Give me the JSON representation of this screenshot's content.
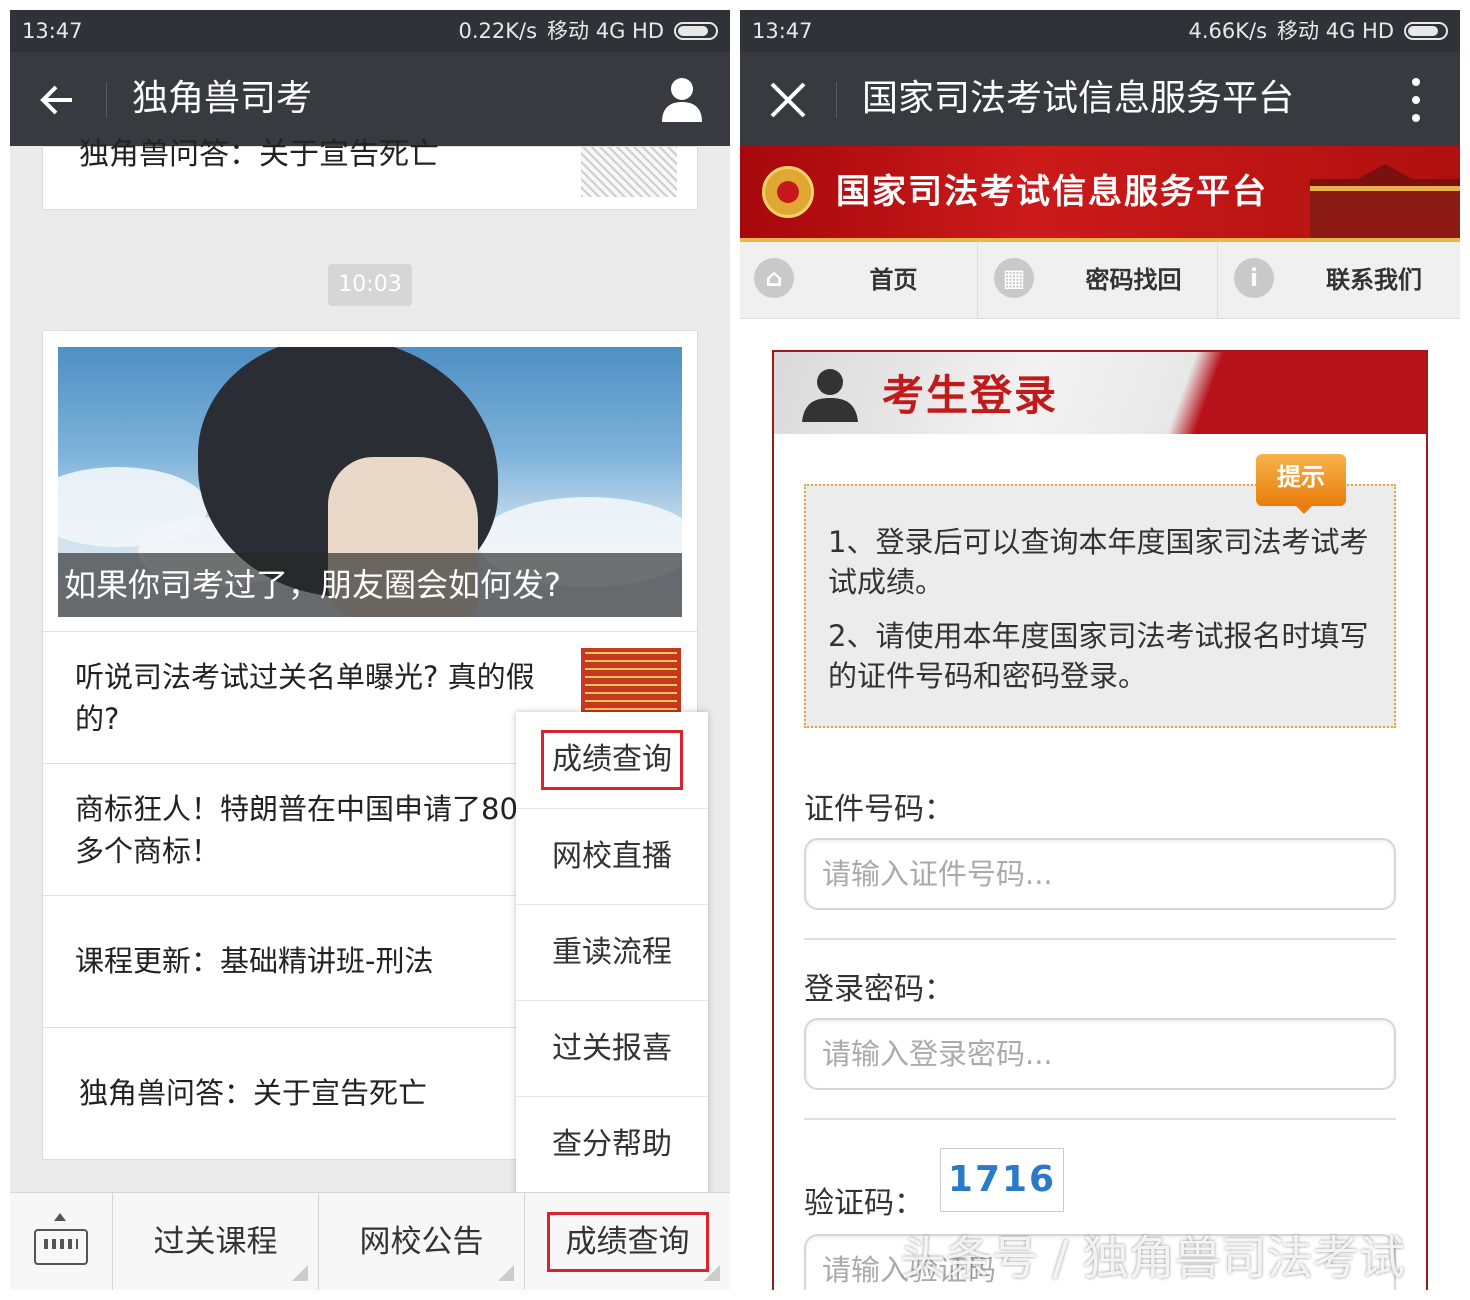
{
  "left": {
    "status": {
      "time": "13:47",
      "speed": "0.22K/s",
      "carrier": "移动 4G HD"
    },
    "title": "独角兽司考",
    "top_card_text": "独角兽问答：关于宣告死亡",
    "time_badge": "10:03",
    "hero_caption": "如果你司考过了，朋友圈会如何发?",
    "items": [
      {
        "text": "听说司法考试过关名单曝光? 真的假的?"
      },
      {
        "text": "商标狂人！特朗普在中国申请了80多个商标！"
      },
      {
        "text": "课程更新：基础精讲班-刑法"
      },
      {
        "text": "独角兽问答：关于宣告死亡"
      }
    ],
    "popup_menu": [
      "成绩查询",
      "网校直播",
      "重读流程",
      "过关报喜",
      "查分帮助"
    ],
    "bottom_menu": [
      "过关课程",
      "网校公告",
      "成绩查询"
    ]
  },
  "right": {
    "status": {
      "time": "13:47",
      "speed": "4.66K/s",
      "carrier": "移动 4G HD"
    },
    "title": "国家司法考试信息服务平台",
    "banner_title": "国家司法考试信息服务平台",
    "nav": [
      "首页",
      "密码找回",
      "联系我们"
    ],
    "login_title": "考生登录",
    "tip_tag": "提示",
    "tips": [
      "1、登录后可以查询本年度国家司法考试考试成绩。",
      "2、请使用本年度国家司法考试报名时填写的证件号码和密码登录。"
    ],
    "id_label": "证件号码：",
    "id_placeholder": "请输入证件号码...",
    "pwd_label": "登录密码：",
    "pwd_placeholder": "请输入登录密码...",
    "captcha_label": "验证码：",
    "captcha_value": "1716",
    "captcha_placeholder": "请输入验证码"
  },
  "watermark": "头条号 / 独角兽司法考试",
  "colors": {
    "titlebar": "#393a3f",
    "highlight_red": "#d9232e",
    "banner_red": "#b7121a",
    "tip_orange": "#e97d0d"
  }
}
